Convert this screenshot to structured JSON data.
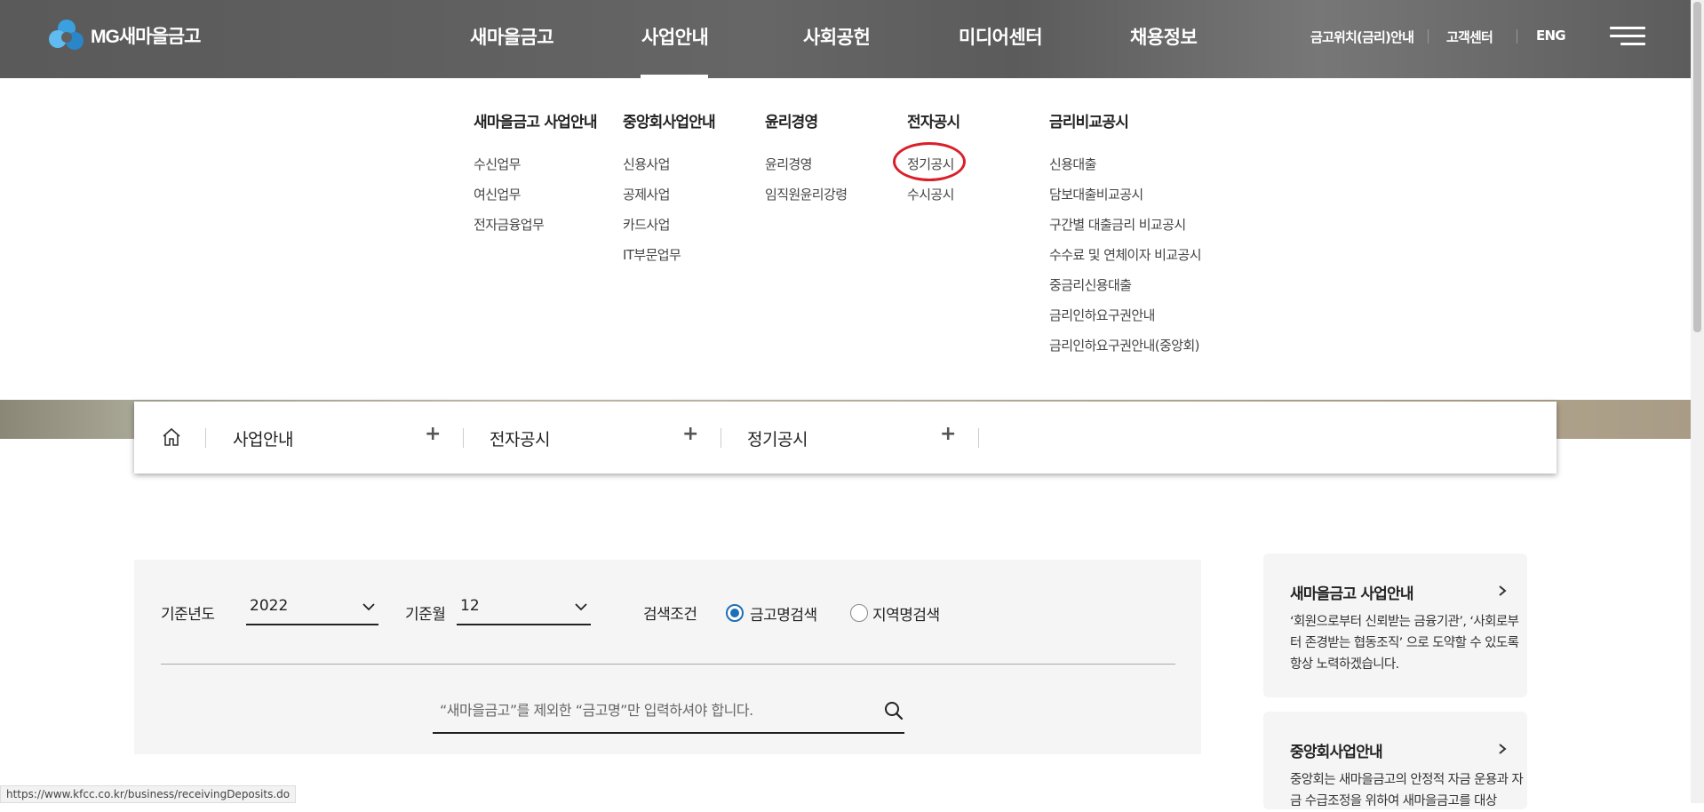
{
  "header": {
    "logo_text": "MG새마을금고",
    "gnb": [
      {
        "label": "새마을금고"
      },
      {
        "label": "사업안내"
      },
      {
        "label": "사회공헌"
      },
      {
        "label": "미디어센터"
      },
      {
        "label": "채용정보"
      }
    ],
    "active_gnb": "사업안내",
    "util": [
      {
        "label": "금고위치(금리)안내"
      },
      {
        "label": "고객센터"
      },
      {
        "label": "ENG"
      }
    ]
  },
  "mega_menu": {
    "columns": [
      {
        "title": "새마을금고 사업안내",
        "links": [
          "수신업무",
          "여신업무",
          "전자금융업무"
        ]
      },
      {
        "title": "중앙회사업안내",
        "links": [
          "신용사업",
          "공제사업",
          "카드사업",
          "IT부문업무"
        ]
      },
      {
        "title": "윤리경영",
        "links": [
          "윤리경영",
          "임직원윤리강령"
        ]
      },
      {
        "title": "전자공시",
        "links": [
          "정기공시",
          "수시공시"
        ]
      },
      {
        "title": "금리비교공시",
        "links": [
          "신용대출",
          "담보대출비교공시",
          "구간별 대출금리 비교공시",
          "수수료 및 연체이자 비교공시",
          "중금리신용대출",
          "금리인하요구권안내",
          "금리인하요구권안내(중앙회)"
        ]
      }
    ],
    "highlighted": "정기공시"
  },
  "location": {
    "items": [
      {
        "label": "사업안내"
      },
      {
        "label": "전자공시"
      },
      {
        "label": "정기공시"
      }
    ]
  },
  "search": {
    "year_label": "기준년도",
    "year_value": "2022",
    "month_label": "기준월",
    "month_value": "12",
    "condition_label": "검색조건",
    "radio_options": [
      {
        "label": "금고명검색",
        "selected": true
      },
      {
        "label": "지역명검색",
        "selected": false
      }
    ],
    "placeholder": "“새마을금고”를 제외한 “금고명”만 입력하셔야 합니다."
  },
  "cards": [
    {
      "title": "새마을금고 사업안내",
      "desc": "‘회원으로부터 신뢰받는 금융기관’, ‘사회로부터 존경받는 협동조직’ 으로 도약할 수 있도록 항상 노력하겠습니다."
    },
    {
      "title": "중앙회사업안내",
      "desc": "중앙회는 새마을금고의 안정적 자금 운용과 자금 수급조정을 위하여 새마을금고를 대상"
    }
  ],
  "status_url": "https://www.kfcc.co.kr/business/receivingDeposits.do",
  "colors": {
    "header_bg": "#5f5f5f",
    "highlight_circle": "#d9202a",
    "radio_selected": "#1f6fb5",
    "panel_bg": "#f5f5f5"
  }
}
